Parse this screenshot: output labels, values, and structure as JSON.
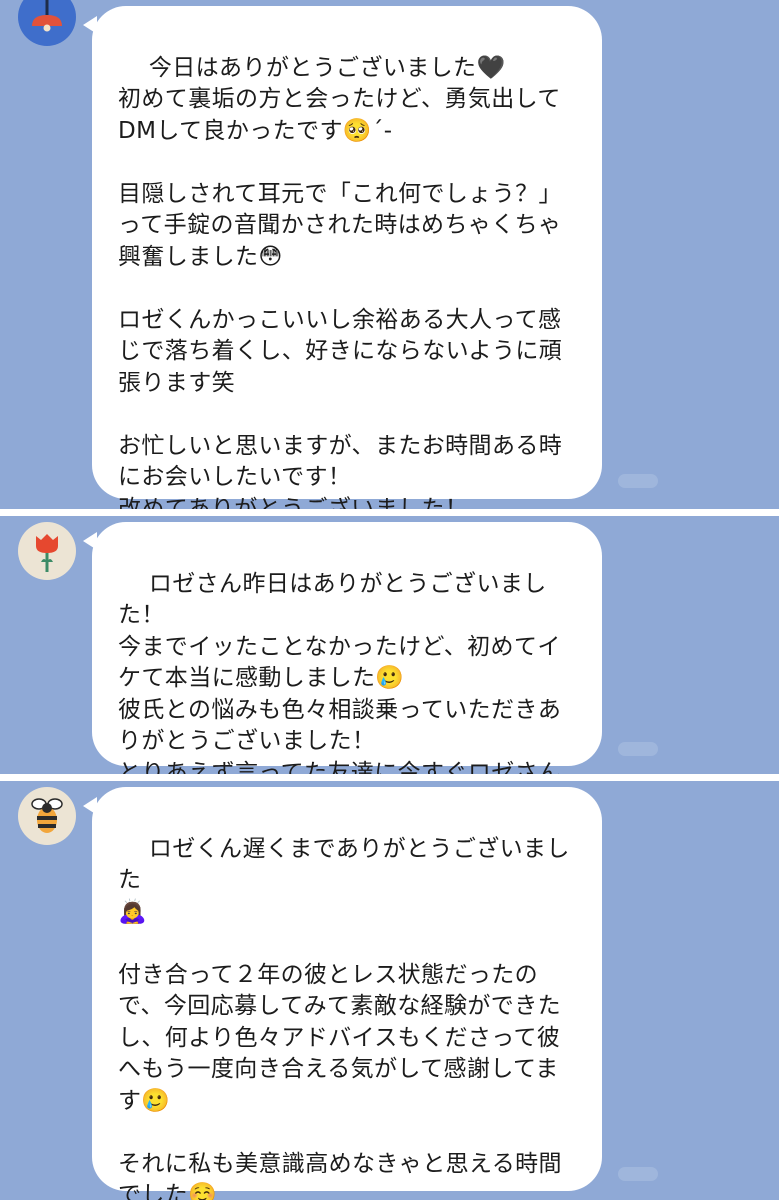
{
  "messages": [
    {
      "avatar_icon": "lamp-icon",
      "text": "今日はありがとうございました🖤\n初めて裏垢の方と会ったけど、勇気出して\nDMして良かったです🥺´-\n\n目隠しされて耳元で「これ何でしょう？」\nって手錠の音聞かされた時はめちゃくちゃ\n興奮しました😳\n\nロゼくんかっこいいし余裕ある大人って感\nじで落ち着くし、好きにならないように頑\n張ります笑\n\nお忙しいと思いますが、またお時間ある時\nにお会いしたいです！\n改めてありがとうございました！"
    },
    {
      "avatar_icon": "tulip-icon",
      "text": "ロゼさん昨日はありがとうございました！\n今までイッたことなかったけど、初めてイ\nケて本当に感動しました🥲\n彼氏との悩みも色々相談乗っていただきあ\nりがとうございました！\nとりあえず言ってた友達に今すぐロゼさん\nオススメしてきます！笑"
    },
    {
      "avatar_icon": "bee-icon",
      "text": "ロゼくん遅くまでありがとうございました\n🙇‍♀️\n\n付き合って２年の彼とレス状態だったの\nで、今回応募してみて素敵な経験ができた\nし、何より色々アドバイスもくださって彼\nへもう一度向き合える気がして感謝してま\nす🥲\n\nそれに私も美意識高めなきゃと思える時間\nでした☺️\n来月も楽しみにしてます！❤"
    }
  ]
}
